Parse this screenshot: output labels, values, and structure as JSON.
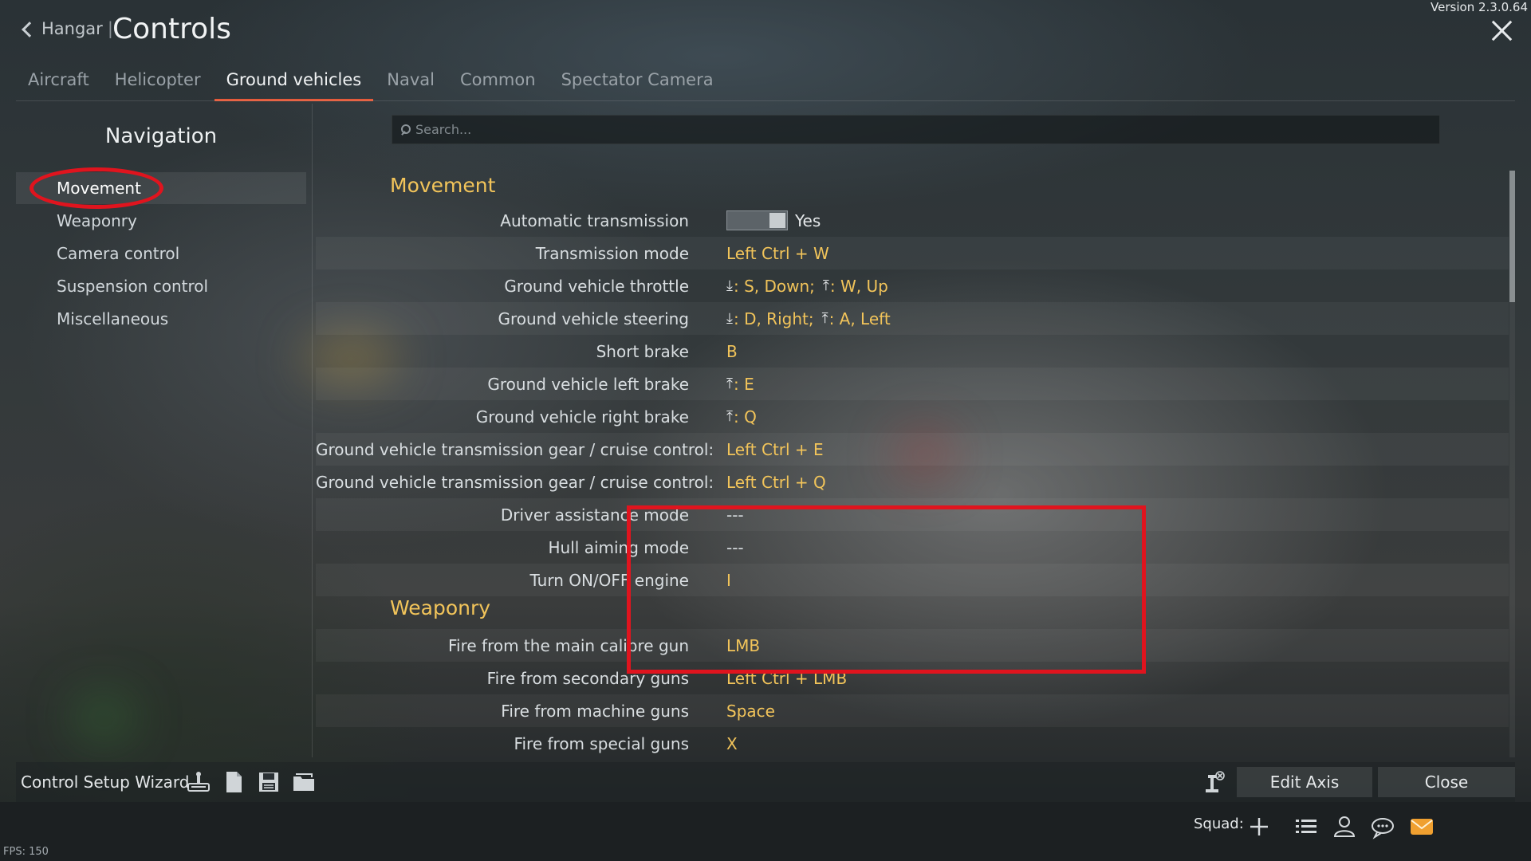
{
  "header": {
    "version": "Version 2.3.0.64",
    "back_label": "Hangar",
    "separator": "|",
    "title": "Controls"
  },
  "tabs": [
    {
      "label": "Aircraft",
      "active": false
    },
    {
      "label": "Helicopter",
      "active": false
    },
    {
      "label": "Ground vehicles",
      "active": true
    },
    {
      "label": "Naval",
      "active": false
    },
    {
      "label": "Common",
      "active": false
    },
    {
      "label": "Spectator Camera",
      "active": false
    }
  ],
  "sidebar": {
    "title": "Navigation",
    "items": [
      {
        "label": "Movement",
        "active": true
      },
      {
        "label": "Weaponry",
        "active": false
      },
      {
        "label": "Camera control",
        "active": false
      },
      {
        "label": "Suspension control",
        "active": false
      },
      {
        "label": "Miscellaneous",
        "active": false
      }
    ]
  },
  "search": {
    "placeholder": "Search..."
  },
  "sections": [
    {
      "title": "Movement",
      "rows": [
        {
          "label": "Automatic transmission",
          "type": "toggle",
          "value": "Yes"
        },
        {
          "label": "Transmission mode",
          "value": "Left Ctrl + W"
        },
        {
          "label": "Ground vehicle throttle",
          "value_parts": [
            {
              "icon": "axis-down-icon",
              "text": ": S, Down;"
            },
            {
              "icon": "axis-up-icon",
              "text": ": W, Up"
            }
          ]
        },
        {
          "label": "Ground vehicle steering",
          "value_parts": [
            {
              "icon": "axis-down-icon",
              "text": ": D, Right;"
            },
            {
              "icon": "axis-up-icon",
              "text": ": A, Left"
            }
          ]
        },
        {
          "label": "Short brake",
          "value": "B"
        },
        {
          "label": "Ground vehicle left brake",
          "value_parts": [
            {
              "icon": "axis-up-icon",
              "text": ": E"
            }
          ]
        },
        {
          "label": "Ground vehicle right brake",
          "value_parts": [
            {
              "icon": "axis-up-icon",
              "text": ": Q"
            }
          ]
        },
        {
          "label": "Ground vehicle transmission gear / cruise control:",
          "value": "Left Ctrl + E"
        },
        {
          "label": "Ground vehicle transmission gear / cruise control:",
          "value": "Left Ctrl + Q"
        },
        {
          "label": "Driver assistance mode",
          "value": "---",
          "plain": true
        },
        {
          "label": "Hull aiming mode",
          "value": "---",
          "plain": true
        },
        {
          "label": "Turn ON/OFF engine",
          "value": "I"
        }
      ]
    },
    {
      "title": "Weaponry",
      "rows": [
        {
          "label": "Fire from the main calibre gun",
          "value": "LMB"
        },
        {
          "label": "Fire from secondary guns",
          "value": "Left Ctrl + LMB"
        },
        {
          "label": "Fire from machine guns",
          "value": "Space"
        },
        {
          "label": "Fire from special guns",
          "value": "X"
        }
      ]
    }
  ],
  "toolbar": {
    "wizard_label": "Control Setup Wizard",
    "icons": [
      "gamepad-setup-icon",
      "new-preset-icon",
      "save-preset-icon",
      "load-preset-icon"
    ],
    "axis_reset_icon": "joystick-reset-icon",
    "edit_axis_label": "Edit Axis",
    "close_label": "Close"
  },
  "bottombar": {
    "squad_label": "Squad:",
    "icons": [
      "add-icon",
      "list-icon",
      "contacts-icon",
      "chat-icon",
      "mail-icon"
    ],
    "fps": "FPS: 150"
  },
  "colors": {
    "accent_yellow": "#f2c45a",
    "tab_underline": "#e45a3a",
    "highlight_red": "#e0141e",
    "mail_orange": "#f0a030"
  }
}
